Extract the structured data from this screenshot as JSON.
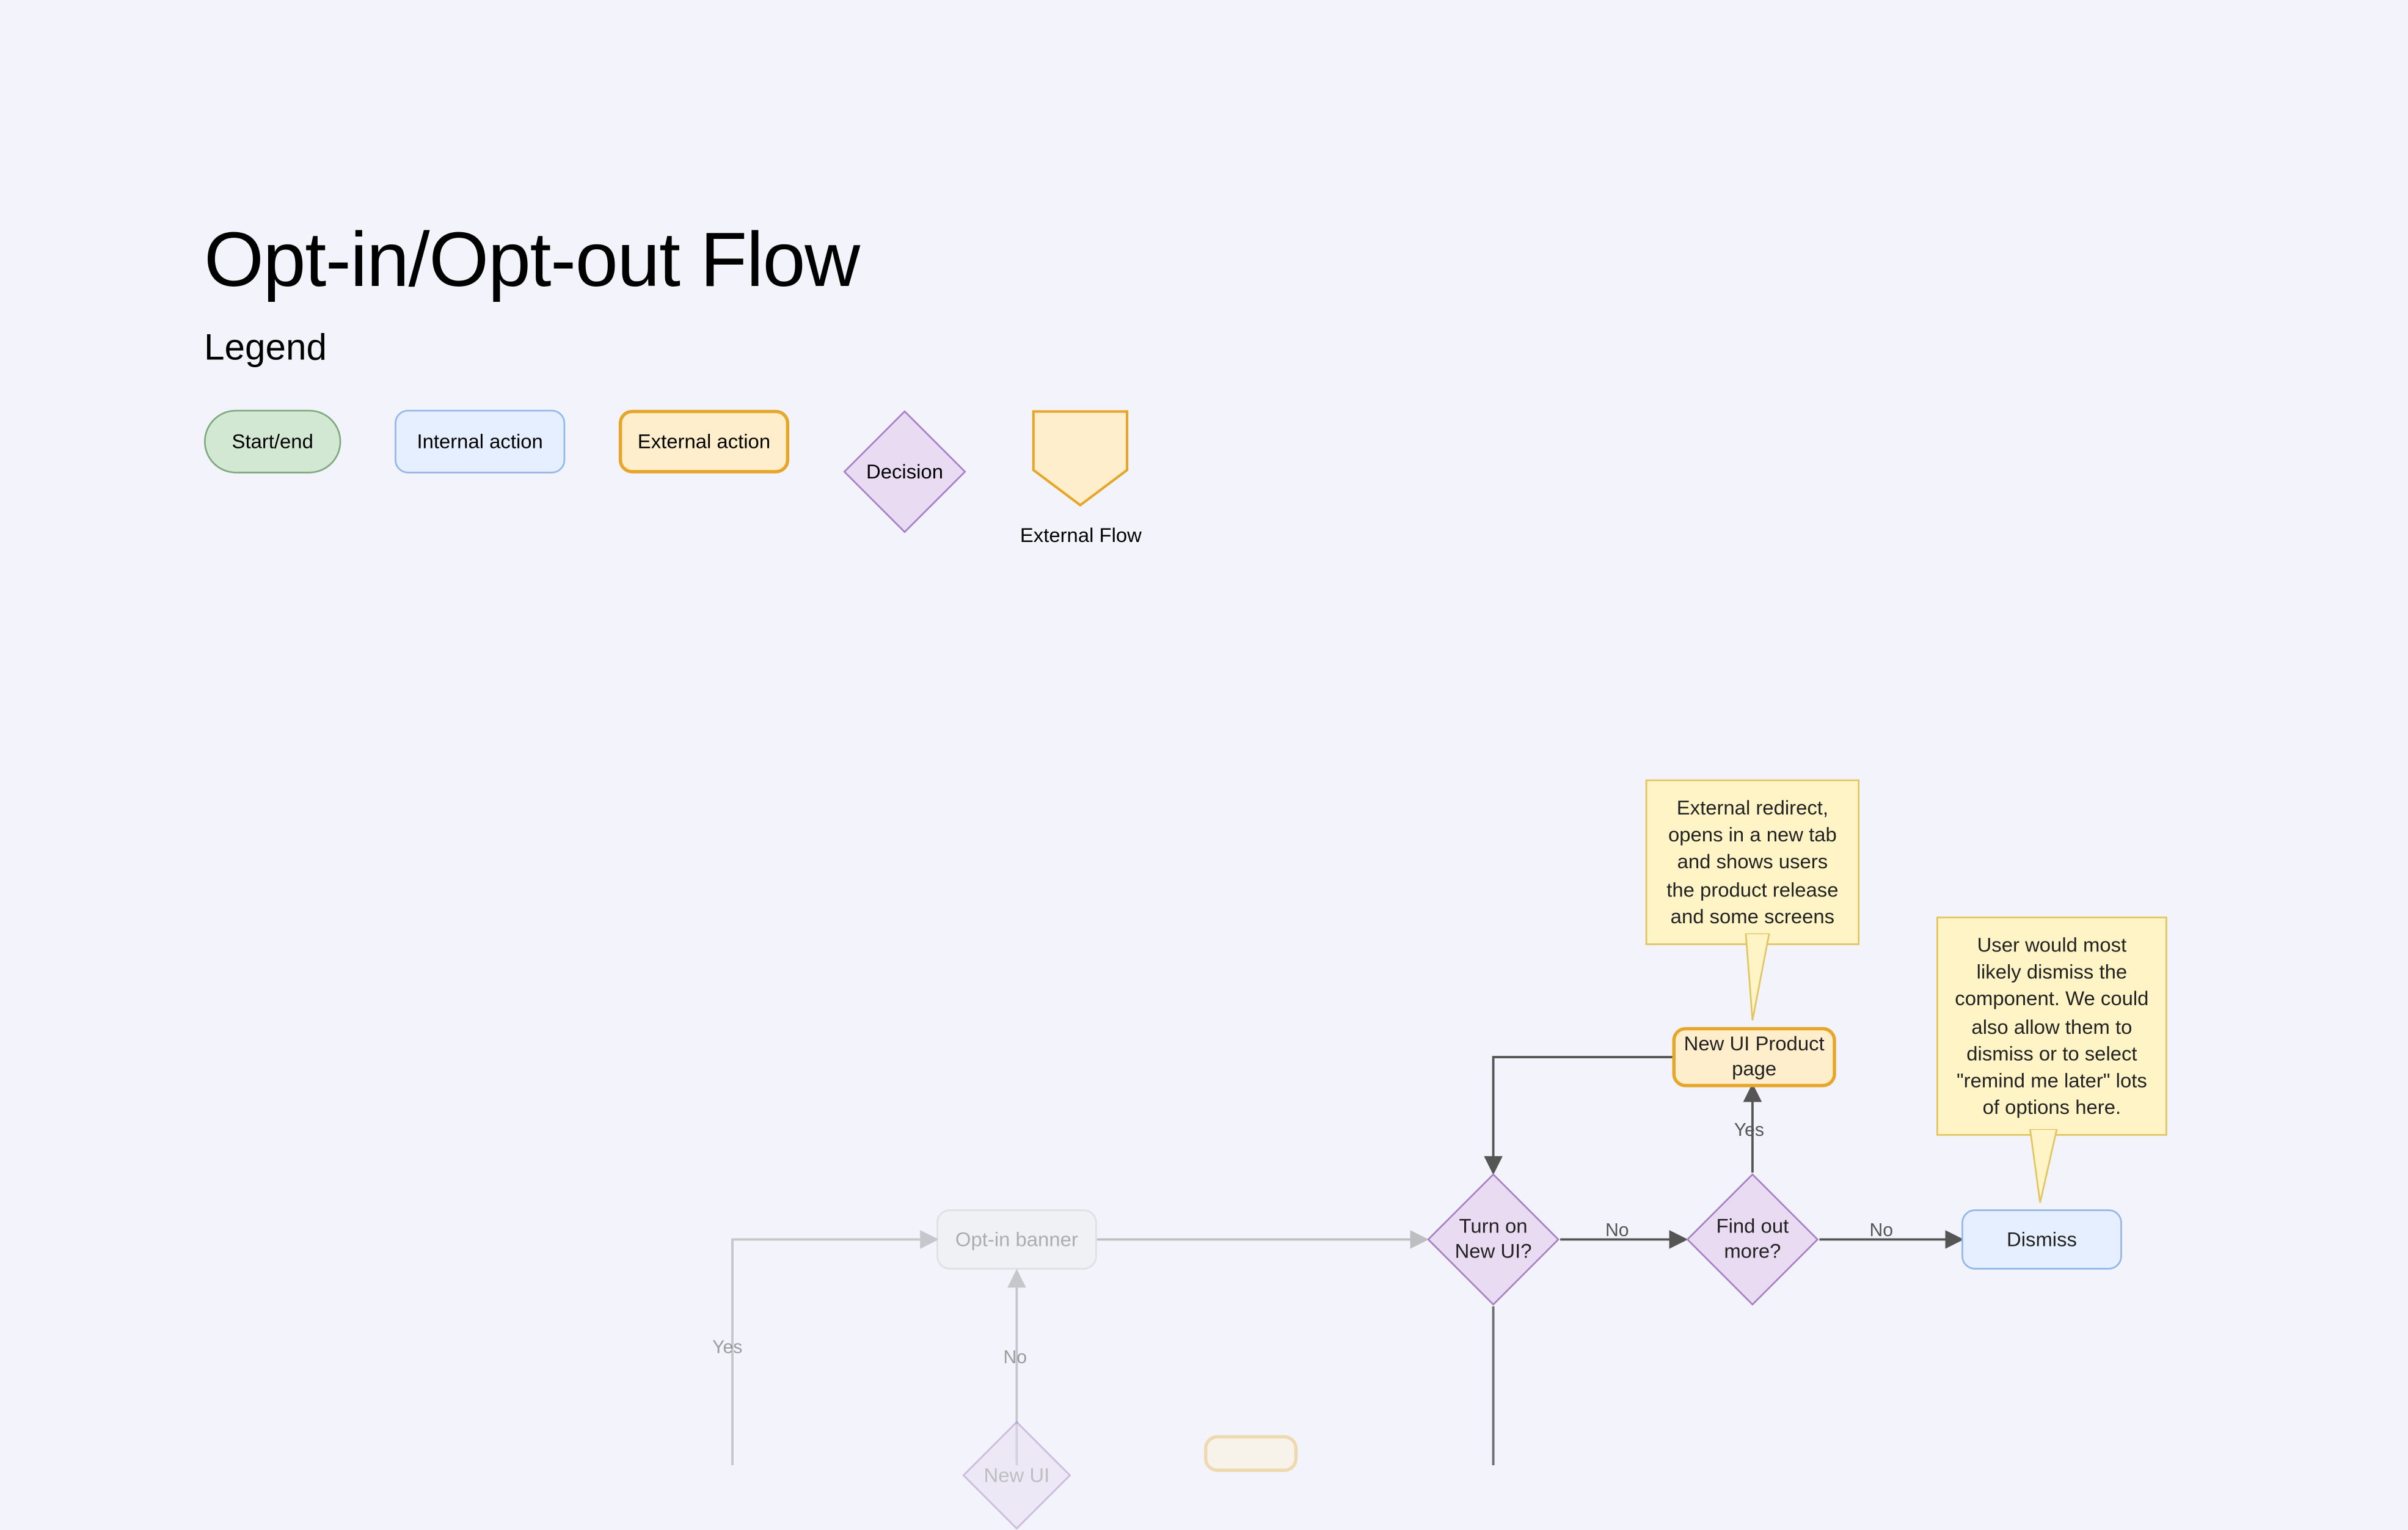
{
  "title": "Opt-in/Opt-out Flow",
  "subtitle": "Legend",
  "legend": {
    "startend": "Start/end",
    "internal": "Internal action",
    "external": "External action",
    "decision": "Decision",
    "extflow": "External Flow"
  },
  "nodes": {
    "optin_banner": "Opt-in banner",
    "turn_on": "Turn on\nNew UI?",
    "find_out": "Find out\nmore?",
    "dismiss": "Dismiss",
    "new_ui_product": "New UI Product\npage",
    "new_ui_partial": "New UI"
  },
  "notes": {
    "redirect": "External redirect, opens in a new tab and shows users the product release and some screens",
    "dismiss": "User would most likely dismiss the component. We could also allow them to dismiss or to select \"remind me later\" lots of options here."
  },
  "labels": {
    "yes": "Yes",
    "no": "No"
  }
}
